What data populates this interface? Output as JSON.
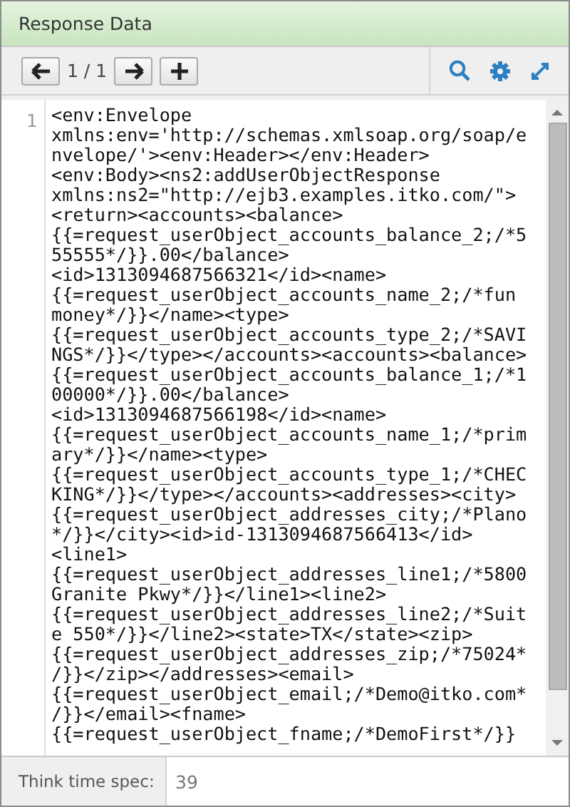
{
  "panel": {
    "title": "Response Data"
  },
  "toolbar": {
    "page_indicator": "1 / 1"
  },
  "editor": {
    "line_number": "1",
    "lines": [
      "<env:Envelope",
      "xmlns:env='http://schemas.xmlsoap.org/soap/e",
      "nvelope/'><env:Header></env:Header>",
      "<env:Body><ns2:addUserObjectResponse",
      "xmlns:ns2=\"http://ejb3.examples.itko.com/\">",
      "<return><accounts><balance>",
      "{{=request_userObject_accounts_balance_2;/*5",
      "55555*/}}.00</balance>",
      "<id>1313094687566321</id><name>",
      "{{=request_userObject_accounts_name_2;/*fun",
      "money*/}}</name><type>",
      "{{=request_userObject_accounts_type_2;/*SAVI",
      "NGS*/}}</type></accounts><accounts><balance>",
      "{{=request_userObject_accounts_balance_1;/*1",
      "00000*/}}.00</balance>",
      "<id>1313094687566198</id><name>",
      "{{=request_userObject_accounts_name_1;/*prim",
      "ary*/}}</name><type>",
      "{{=request_userObject_accounts_type_1;/*CHEC",
      "KING*/}}</type></accounts><addresses><city>",
      "{{=request_userObject_addresses_city;/*Plano",
      "*/}}</city><id>id-1313094687566413</id>",
      "<line1>",
      "{{=request_userObject_addresses_line1;/*5800",
      "Granite Pkwy*/}}</line1><line2>",
      "{{=request_userObject_addresses_line2;/*Suit",
      "e 550*/}}</line2><state>TX</state><zip>",
      "{{=request_userObject_addresses_zip;/*75024*",
      "/}}</zip></addresses><email>",
      "{{=request_userObject_email;/*Demo@itko.com*",
      "/}}</email><fname>",
      "{{=request_userObject_fname;/*DemoFirst*/}}"
    ]
  },
  "footer": {
    "label": "Think time spec:",
    "value": "39"
  }
}
